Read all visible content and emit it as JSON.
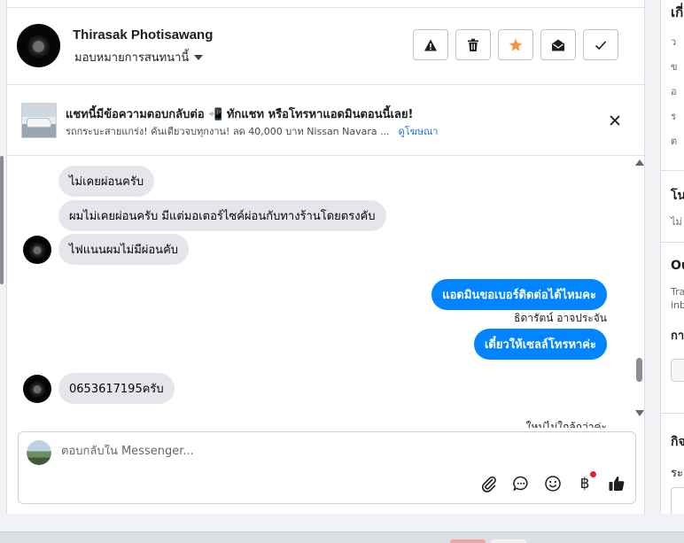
{
  "header": {
    "contact_name": "Thirasak Photisawang",
    "assign_label": "มอบหมายการสนทนานี้",
    "actions": [
      {
        "icon": "warning-icon"
      },
      {
        "icon": "trash-icon"
      },
      {
        "icon": "star-icon",
        "color": "#f7923b"
      },
      {
        "icon": "envelope-open-icon"
      },
      {
        "icon": "check-icon"
      }
    ]
  },
  "ad": {
    "title": "แชทนี้มีข้อความตอบกลับต่อ 📲 ทักแชท หรือโทรหาแอดมินตอนนี้เลย!",
    "description": "รถกระบะสายแกร่ง! คันเดียวจบทุกงาน! ลด 40,000 บาท Nissan Navara ...",
    "link_label": "ดูโฆษณา"
  },
  "messages": [
    {
      "dir": "in",
      "text": "ไม่เคยผ่อนครับ"
    },
    {
      "dir": "in",
      "text": "ผมไม่เคยผ่อนครับ มีแต่มอเตอร์ไซค์ผ่อนกับทางร้านโดยตรงคับ"
    },
    {
      "dir": "in",
      "text": "ไฟแนนผมไม่มีผ่อนคับ"
    },
    {
      "dir": "out",
      "text": "แอดมินขอเบอร์ติดต่อได้ไหมคะ"
    },
    {
      "dir": "out",
      "text": "เดี๋ยวให้เซลล์โทรหาค่ะ"
    },
    {
      "dir": "in",
      "text": "0653617195ครับ"
    }
  ],
  "sender_tag": "ธิดารัตน์ อาจประจัน",
  "truncated_line": "ใหม่ไม่ใกล้กว่าค่ะ",
  "composer": {
    "placeholder": "ตอบกลับใน Messenger...",
    "tools": [
      "paperclip-icon",
      "chat-bubble-icon",
      "smiley-icon",
      "baht-icon",
      "thumbs-up-icon"
    ],
    "baht_symbol": "฿"
  },
  "right_panel": {
    "header_fragment": "เกี่",
    "section_1": "โน",
    "section_1_sub": "ไม่",
    "section_2": "Ou",
    "section_2_sub_1": "Tra",
    "section_2_sub_2": "inb",
    "section_2_label": "กา",
    "section_3": "กิจ",
    "section_3_label": "ระ",
    "dots": [
      "ว",
      "ข",
      "อ",
      "ร",
      "ต"
    ]
  },
  "colors": {
    "accent": "#0084ff",
    "link": "#1877f2",
    "incoming_bubble": "#e4e6eb",
    "star": "#f7923b",
    "notification": "#e41e3f"
  }
}
